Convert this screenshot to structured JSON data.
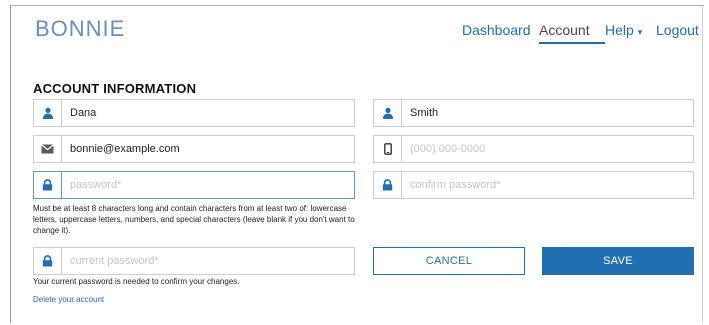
{
  "brand": {
    "name": "BONNIE"
  },
  "nav": {
    "dashboard": "Dashboard",
    "account": "Account",
    "help": "Help",
    "help_caret": "▾",
    "logout": "Logout"
  },
  "form": {
    "section_title": "ACCOUNT INFORMATION",
    "first_name": {
      "value": "Dana",
      "icon": "user-icon"
    },
    "last_name": {
      "value": "Smith",
      "icon": "user-icon"
    },
    "email": {
      "value": "bonnie@example.com",
      "icon": "envelope-icon"
    },
    "phone": {
      "placeholder": "(000) 000-0000",
      "icon": "mobile-phone-icon"
    },
    "password": {
      "placeholder": "password*",
      "icon": "lock-icon"
    },
    "confirm_password": {
      "placeholder": "confirm password*",
      "icon": "lock-icon"
    },
    "password_hint": "Must be at least 8 characters long and contain characters from at least two of: lowercase letters, uppercase letters, numbers, and special characters (leave blank if you don't want to change it).",
    "current_password": {
      "placeholder": "current password*",
      "icon": "lock-icon"
    },
    "current_password_hint": "Your current password is needed to confirm your changes.",
    "delete_account": "Delete your account",
    "cancel_label": "CANCEL",
    "save_label": "SAVE"
  },
  "colors": {
    "accent": "#1f6fb2",
    "logo": "#6a8fbf",
    "focus_border": "#5a9ad6"
  }
}
